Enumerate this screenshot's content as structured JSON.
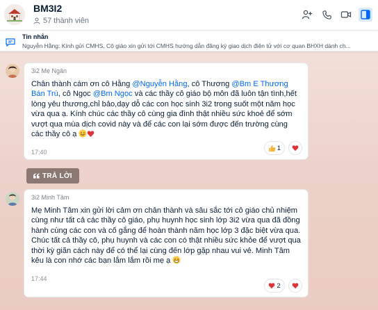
{
  "header": {
    "group_name": "BM3I2",
    "member_count": "57 thành viên"
  },
  "pinned": {
    "title": "Tin nhắn",
    "text": "Nguyễn Hằng: Kính gửi CMHS, Cô giáo xin gửi tới CMHS hướng dẫn đăng ký giao dịch điện tử với cơ quan BHXH dành ch..."
  },
  "messages": [
    {
      "sender": "3i2 Mẹ Ngân",
      "parts": {
        "p1": "Chân thành cám ơn cô Hằng ",
        "m1": "@Nguyễn Hằng",
        "p2": ", cô Thương ",
        "m2": "@Bm E Thương Bán Trú",
        "p3": ", cô Ngọc ",
        "m3": "@Bm Ngọc",
        "p4": " và các thầy cô giáo bộ môn đã luôn tận tình,hết lòng yêu thương,chỉ bảo,dạy dỗ các con học sinh 3i2 trong suốt một năm học vừa qua ạ. Kính chúc các thầy cô cùng gia đình thật nhiều sức khoẻ để sớm vượt qua mùa dịch covid này và để các con lại sớm được đến trường cùng các thầy cô ạ "
      },
      "time": "17:40",
      "reaction_count": "1"
    },
    {
      "sender": "3i2 Minh Tâm",
      "text": "Mẹ Minh Tâm xin gửi lời cảm ơn chân thành và sâu sắc tới cô giáo chủ nhiệm cùng như tất cả các thầy cô giáo, phụ huynh học sinh lớp 3i2 vừa qua đã đồng hành cùng các con và cố gắng để hoàn thành năm học lớp 3 đặc biệt vừa qua. Chúc tất cả thầy cô, phụ huynh và các con có thật nhiều sức khỏe để vượt qua thời kỳ giãn cách này để có thể lại cùng đến lớp gặp nhau vui vẻ. Minh Tâm kêu là con nhớ các bạn lắm lắm rồi mẹ ạ ",
      "time": "17:44",
      "reaction_count": "2"
    }
  ],
  "reply_label": "TRẢ LỜI",
  "colors": {
    "mention": "#0068ff",
    "chat_bg": "#ecd2ca",
    "reply_btn": "#8b7872",
    "heart": "#e0323a",
    "active_icon": "#0068ff"
  }
}
